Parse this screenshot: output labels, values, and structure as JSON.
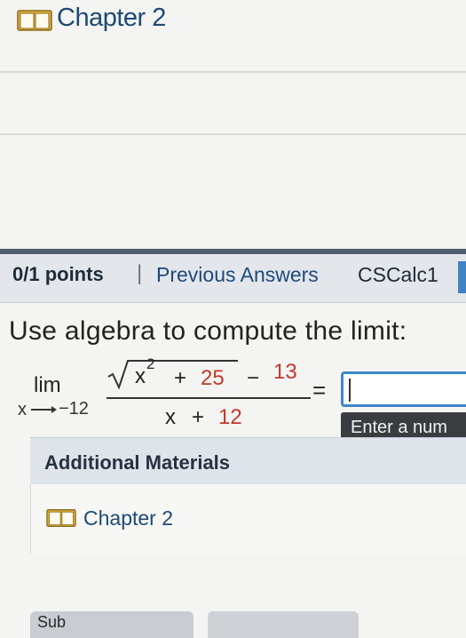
{
  "header": {
    "chapter_link": "Chapter 2",
    "book_icon": "book-icon"
  },
  "points_bar": {
    "points": "0/1 points",
    "separator": "|",
    "previous_answers": "Previous Answers",
    "course_code": "CSCalc1"
  },
  "question": {
    "prompt": "Use algebra to compute the limit:",
    "limit": {
      "lim_label": "lim",
      "sub_var": "x",
      "sub_value": "−12",
      "numerator": {
        "var": "x",
        "exponent": "2",
        "plus": "+",
        "constant": "25",
        "minus": "−",
        "subtract": "13"
      },
      "denominator": {
        "var": "x",
        "plus": "+",
        "constant": "12"
      },
      "equals": "="
    },
    "answer": {
      "value": "",
      "tooltip": "Enter a num"
    }
  },
  "additional_materials": {
    "title": "Additional Materials",
    "items": [
      {
        "label": "Chapter 2",
        "icon": "book-icon"
      }
    ]
  },
  "footer": {
    "submit_label": "Sub"
  },
  "colors": {
    "link": "#1d4a73",
    "highlight_red": "#c0392b",
    "input_border": "#3d86c8",
    "points_bar_bg": "#e3e6ea",
    "tooltip_bg": "#3a3d40"
  }
}
